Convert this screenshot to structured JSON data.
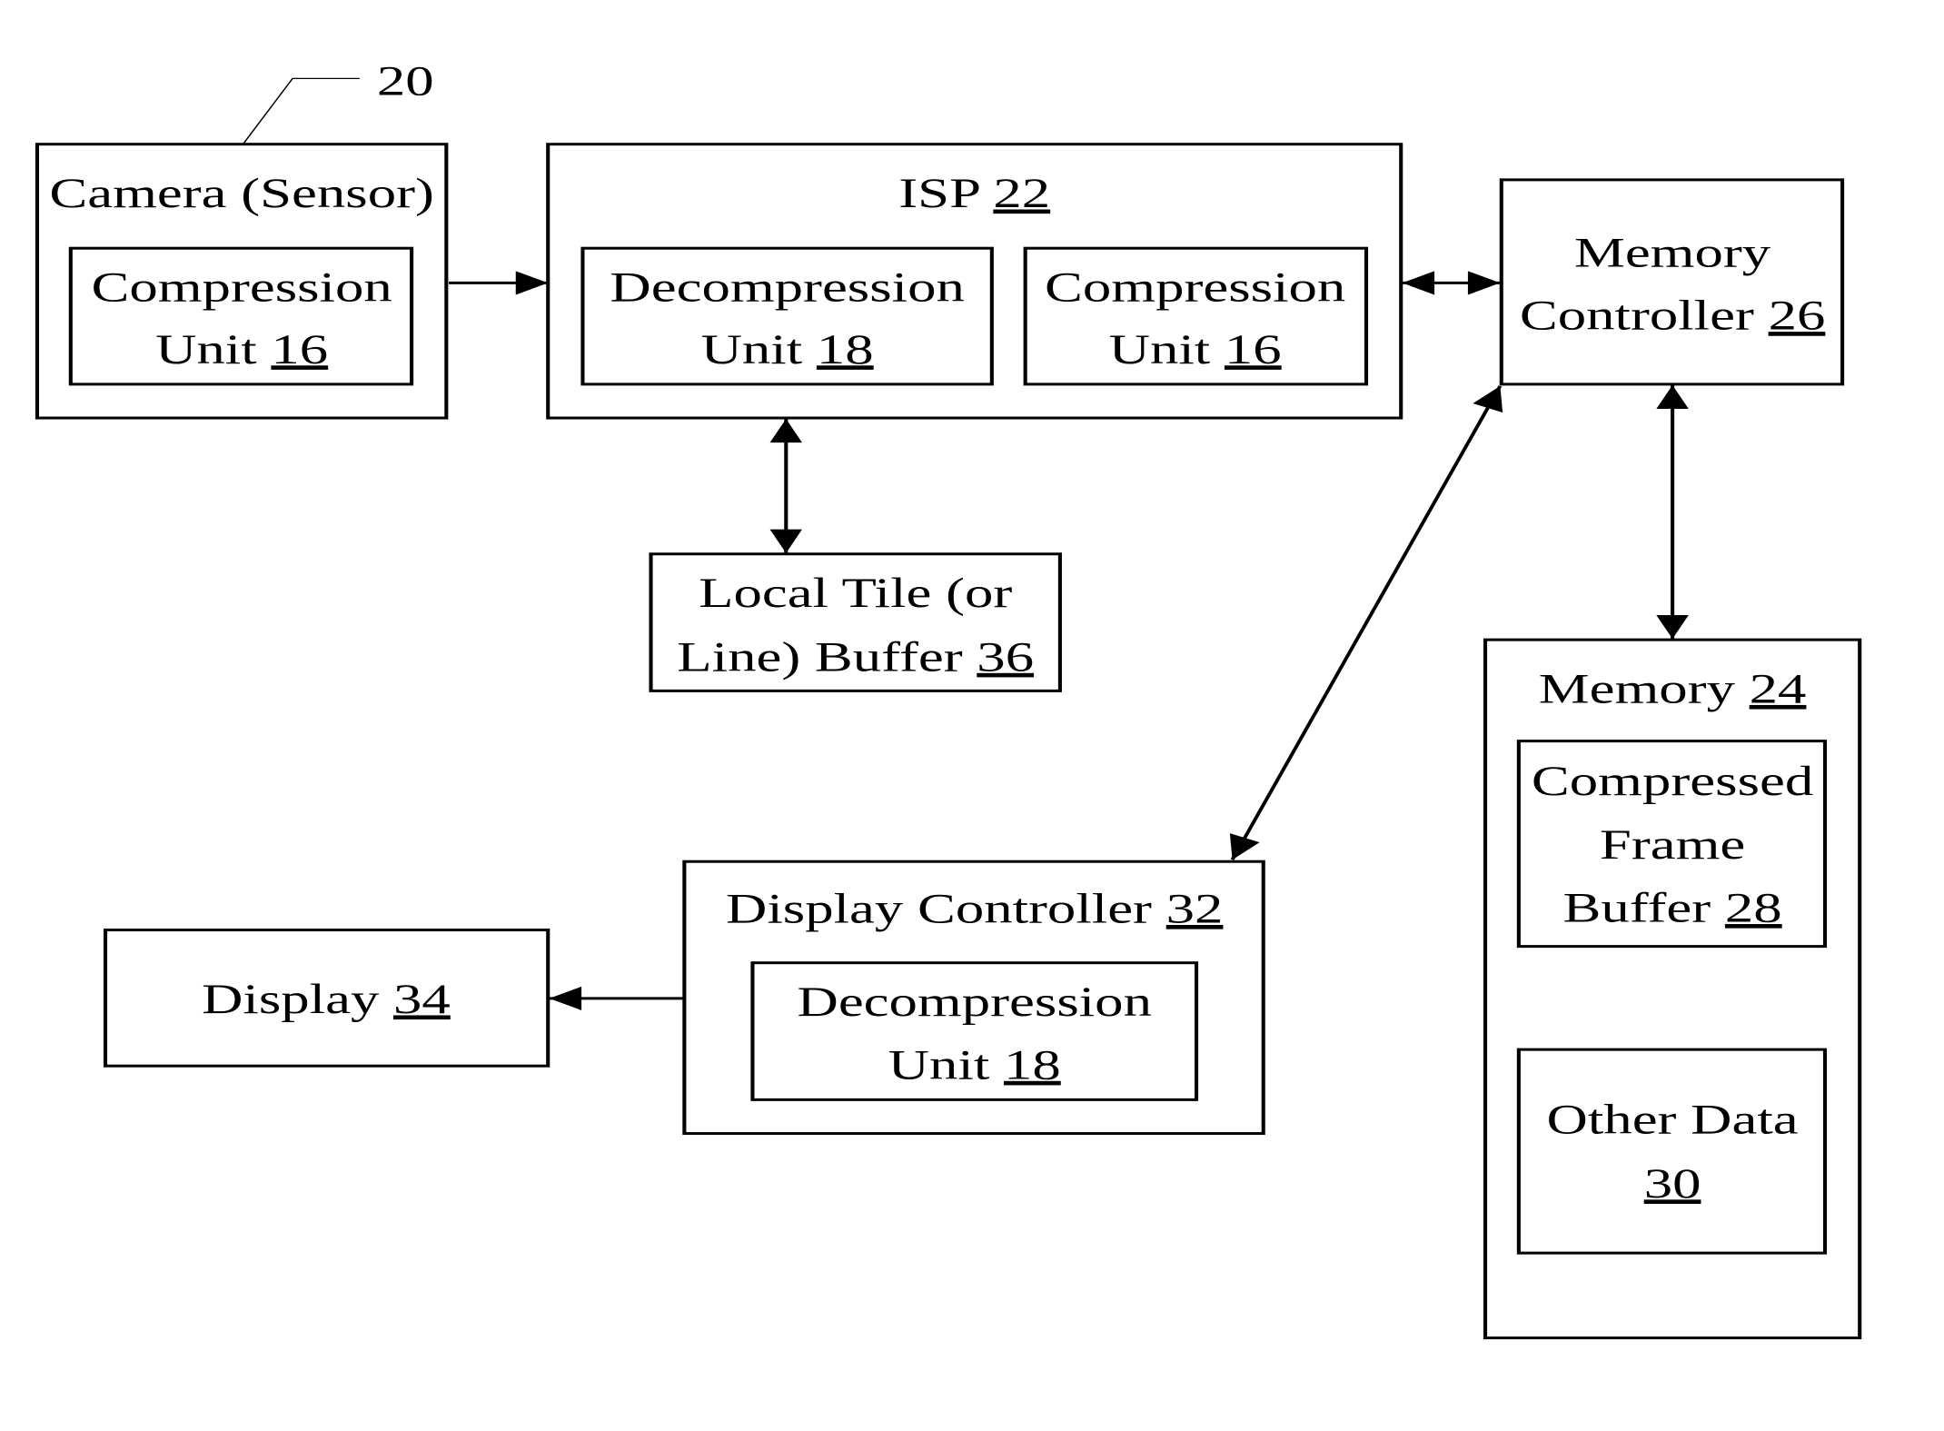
{
  "figure": {
    "ref_label": "20",
    "blocks": {
      "camera": {
        "title": "Camera (Sensor)",
        "inner": {
          "line1": "Compression",
          "line2_text": "Unit ",
          "line2_ref": "16"
        }
      },
      "isp": {
        "title_text": "ISP ",
        "title_ref": "22",
        "decompression": {
          "line1": "Decompression",
          "line2_text": "Unit ",
          "line2_ref": "18"
        },
        "compression": {
          "line1": "Compression",
          "line2_text": "Unit ",
          "line2_ref": "16"
        }
      },
      "memory_controller": {
        "line1": "Memory",
        "line2_text": "Controller ",
        "line2_ref": "26"
      },
      "local_buffer": {
        "line1": "Local Tile (or",
        "line2_text": "Line) Buffer ",
        "line2_ref": "36"
      },
      "memory": {
        "title_text": "Memory ",
        "title_ref": "24",
        "frame_buffer": {
          "line1": "Compressed",
          "line2": "Frame",
          "line3_text": "Buffer ",
          "line3_ref": "28"
        },
        "other_data": {
          "line1": "Other Data",
          "line2_ref": "30"
        }
      },
      "display_controller": {
        "title_text": "Display Controller ",
        "title_ref": "32",
        "decompression": {
          "line1": "Decompression",
          "line2_text": "Unit ",
          "line2_ref": "18"
        }
      },
      "display": {
        "title_text": "Display ",
        "title_ref": "34"
      }
    },
    "connections": [
      {
        "from": "camera",
        "to": "isp",
        "direction": "one-way"
      },
      {
        "from": "isp",
        "to": "memory_controller",
        "direction": "two-way"
      },
      {
        "from": "isp",
        "to": "local_buffer",
        "direction": "two-way"
      },
      {
        "from": "memory_controller",
        "to": "memory",
        "direction": "two-way"
      },
      {
        "from": "memory_controller",
        "to": "display_controller",
        "direction": "two-way"
      },
      {
        "from": "display_controller",
        "to": "display",
        "direction": "one-way"
      }
    ]
  }
}
